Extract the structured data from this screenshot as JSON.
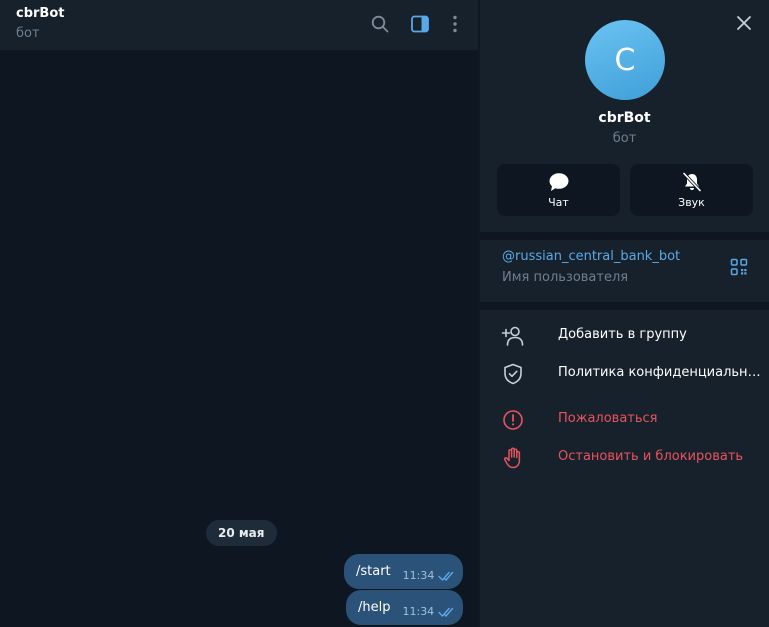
{
  "header": {
    "title": "cbrBot",
    "subtitle": "бот"
  },
  "chat": {
    "date_label": "20 мая",
    "messages": [
      {
        "text": "/start",
        "time": "11:34"
      },
      {
        "text": "/help",
        "time": "11:34"
      }
    ]
  },
  "profile": {
    "avatar_letter": "C",
    "name": "cbrBot",
    "subtitle": "бот",
    "actions": [
      {
        "label": "Чат",
        "icon": "chat-bubble-icon"
      },
      {
        "label": "Звук",
        "icon": "bell-muted-icon"
      }
    ],
    "username": "@russian_central_bank_bot",
    "username_label": "Имя пользователя",
    "menu": [
      {
        "label": "Добавить в группу",
        "icon": "add-user-icon"
      },
      {
        "label": "Политика конфиденциальности",
        "icon": "shield-check-icon"
      },
      {
        "label": "Пожаловаться",
        "icon": "alert-circle-icon"
      },
      {
        "label": "Остановить и блокировать",
        "icon": "hand-stop-icon"
      }
    ]
  },
  "colors": {
    "accent": "#5ba8e8",
    "danger": "#e5545e",
    "bubble": "#2b5278",
    "panel": "#17212b",
    "background": "#0e1621"
  }
}
